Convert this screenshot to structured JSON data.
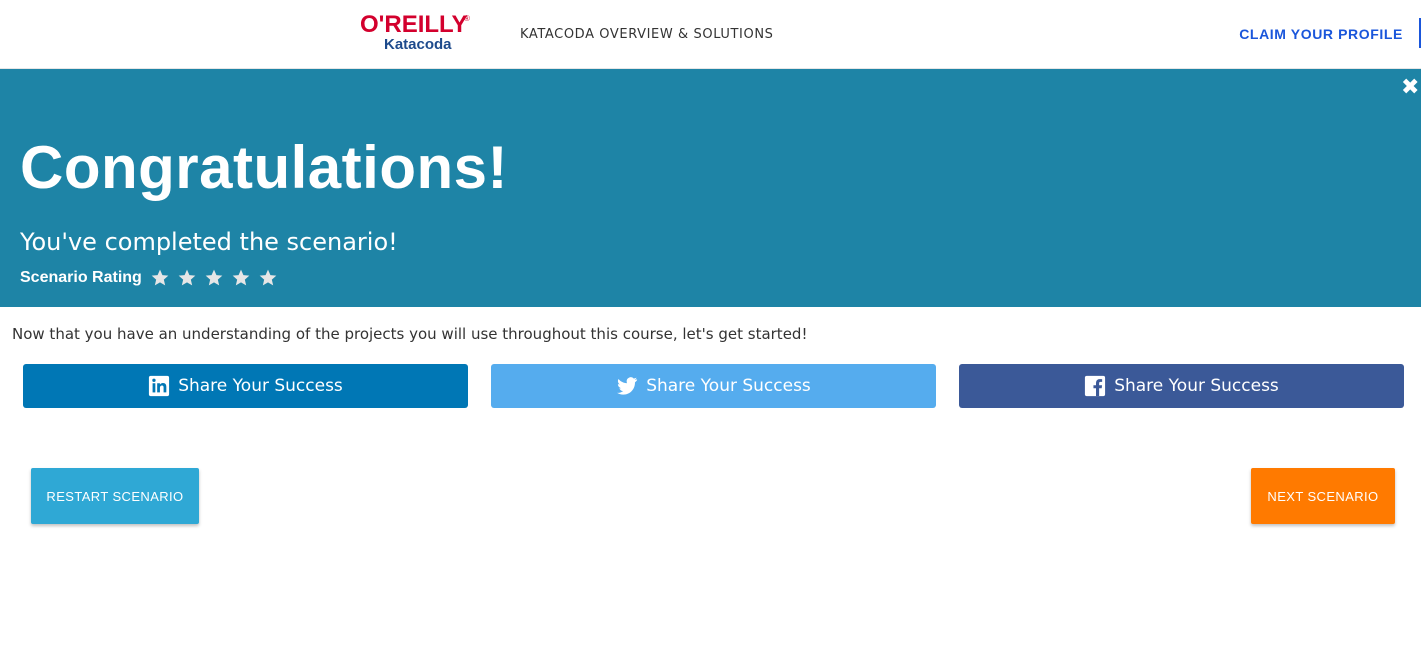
{
  "header": {
    "brand_top": "O'REILLY",
    "brand_bottom": "Katacoda",
    "nav_overview": "KATACODA OVERVIEW & SOLUTIONS",
    "nav_claim": "CLAIM YOUR PROFILE"
  },
  "banner": {
    "close_glyph": "✖",
    "title": "Congratulations!",
    "subtitle": "You've completed the scenario!",
    "rating_label": "Scenario Rating",
    "rating_stars": 5,
    "background_color": "#1e84a6"
  },
  "main": {
    "description": "Now that you have an understanding of the projects you will use throughout this course, let's get started!"
  },
  "share_buttons": [
    {
      "network": "linkedin",
      "icon": "linkedin-icon",
      "label": "Share Your Success",
      "color": "#0077b5"
    },
    {
      "network": "twitter",
      "icon": "twitter-icon",
      "label": "Share Your Success",
      "color": "#55acee"
    },
    {
      "network": "facebook",
      "icon": "facebook-icon",
      "label": "Share Your Success",
      "color": "#3b5998"
    }
  ],
  "actions": {
    "restart_label": "RESTART SCENARIO",
    "next_label": "NEXT SCENARIO",
    "restart_color": "#2fa8d5",
    "next_color": "#ff7a00"
  }
}
